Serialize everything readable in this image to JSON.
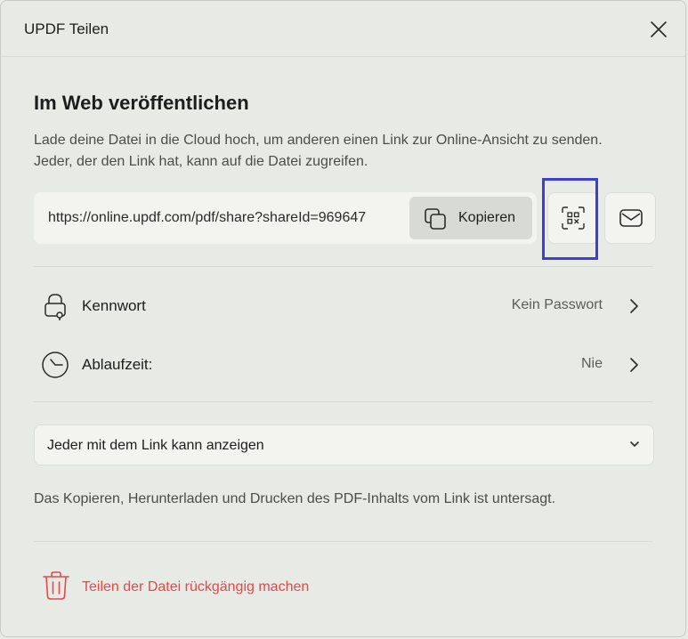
{
  "window": {
    "title": "UPDF Teilen"
  },
  "publish": {
    "heading": "Im Web veröffentlichen",
    "description": "Lade deine Datei in die Cloud hoch, um anderen einen Link zur Online-Ansicht zu senden. Jeder, der den Link hat, kann auf die Datei zugreifen.",
    "link": "https://online.updf.com/pdf/share?shareId=969647",
    "copy_label": "Kopieren"
  },
  "settings": {
    "password": {
      "label": "Kennwort",
      "value": "Kein Passwort"
    },
    "expiry": {
      "label": "Ablaufzeit:",
      "value": "Nie"
    }
  },
  "permission": {
    "selected": "Jeder mit dem Link kann anzeigen"
  },
  "note": "Das Kopieren, Herunterladen und Drucken des PDF-Inhalts vom Link ist untersagt.",
  "revoke": {
    "label": "Teilen der Datei rückgängig machen"
  },
  "colors": {
    "highlight": "#3c3fd0",
    "danger": "#e14a4a",
    "background": "#e8eae5"
  }
}
